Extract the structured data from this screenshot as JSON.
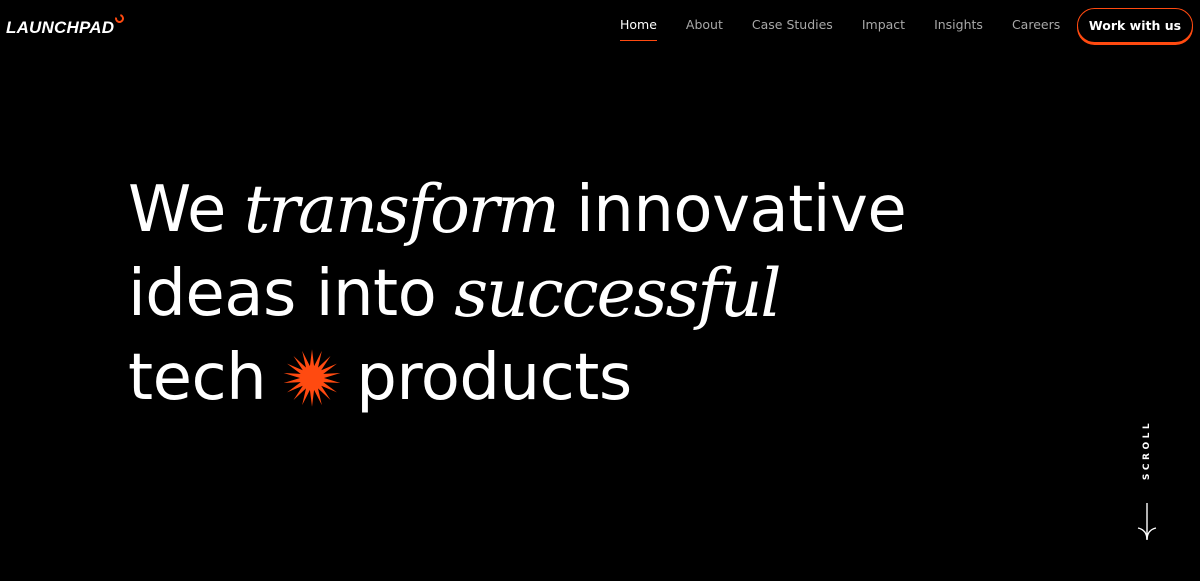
{
  "brand": {
    "name": "LAUNCHPAD",
    "accent_color": "#ff4a10"
  },
  "nav": {
    "items": [
      {
        "label": "Home",
        "active": true
      },
      {
        "label": "About",
        "active": false
      },
      {
        "label": "Case Studies",
        "active": false
      },
      {
        "label": "Impact",
        "active": false
      },
      {
        "label": "Insights",
        "active": false
      },
      {
        "label": "Careers",
        "active": false
      }
    ],
    "cta_label": "Work with us"
  },
  "hero": {
    "line1": {
      "a": "We",
      "b": "transform",
      "c": "innovative"
    },
    "line2": {
      "a": "ideas into",
      "b": "successful"
    },
    "line3": {
      "a": "tech",
      "icon": "starburst-icon",
      "b": "products"
    }
  },
  "scroll": {
    "label": "SCROLL",
    "icon": "arrow-down-icon"
  }
}
